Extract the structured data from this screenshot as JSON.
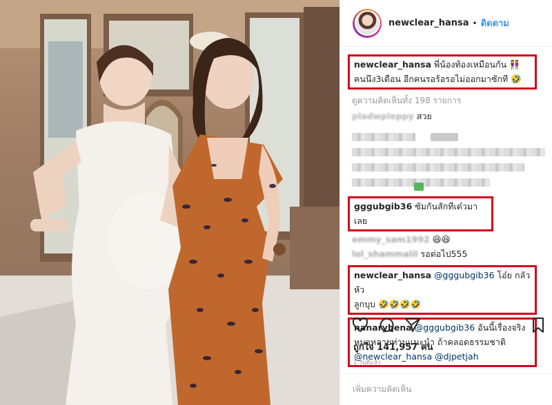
{
  "post": {
    "username": "newclear_hansa",
    "separator": "•",
    "follow_label": "ติดตาม",
    "caption": {
      "username": "newclear_hansa",
      "line1": "พี่น้องท้องเหมือนกัน 👭",
      "line2": "คนนึง3เดือน อีกคนรอร้อรอไม่ออกมาซักที 🤣"
    },
    "view_all_comments": "ดูความคิดเห็นทั้ง 198 รายการ",
    "comments": [
      {
        "username": "pladwpleppy",
        "text": "สวย"
      },
      {
        "username": "gggubgib36",
        "text": "ซัมกันสักทีเด๋วมาเลย"
      },
      {
        "username": "emmy_sam1992",
        "text": "😆😆"
      },
      {
        "username": "lol_shammalil",
        "text": "รอต่อไป555"
      },
      {
        "username": "newclear_hansa",
        "mention": "@gggubgib36",
        "text_line1": "โอ๋ย กลัวหัว",
        "text_line2": "ลูกบุบ 🤣🤣🤣🤣"
      },
      {
        "username": "nanarybena",
        "mention1": "@gggubgib36",
        "text_line1": "อันนี้เรื่องจริง",
        "text_line2": "หมอหลายท่านแนะนำ ถ้าคลอดธรรมชาติ",
        "mention2": "@newclear_hansa",
        "mention3": "@djpetjah"
      }
    ],
    "likes": "ถูกใจ 141,957 คน",
    "time_ago": "1 วันที่แล้ว",
    "add_comment_placeholder": "เพิ่มความคิดเห็น",
    "icons": [
      "heart-icon",
      "comment-icon",
      "share-icon",
      "bookmark-icon"
    ],
    "colors": {
      "highlight_box": "#d0021b",
      "follow_blue": "#3897f0",
      "mention": "#003569"
    }
  }
}
